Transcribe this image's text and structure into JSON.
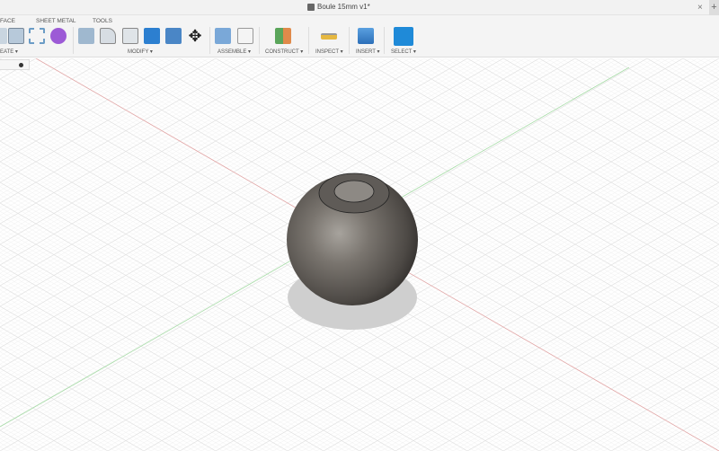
{
  "document": {
    "title": "Boule 15mm v1*",
    "close": "×",
    "new_tab": "+"
  },
  "toolbar": {
    "tabs": [
      "FACE",
      "SHEET METAL",
      "TOOLS"
    ],
    "groups": [
      "EATE ▾",
      "MODIFY ▾",
      "ASSEMBLE ▾",
      "CONSTRUCT ▾",
      "INSPECT ▾",
      "INSERT ▾",
      "SELECT ▾"
    ]
  },
  "colors": {
    "accent": "#1f8ad8",
    "model": "#6a655f",
    "grid": "#e3e3e3"
  }
}
